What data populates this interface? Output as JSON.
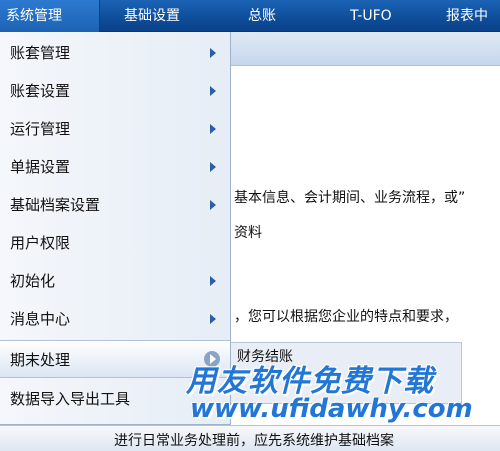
{
  "menubar": {
    "items": [
      "系统管理",
      "基础设置",
      "总账",
      "T-UFO",
      "报表中"
    ]
  },
  "dropdown": {
    "items": [
      {
        "label": "账套管理",
        "has_submenu": true
      },
      {
        "label": "账套设置",
        "has_submenu": true
      },
      {
        "label": "运行管理",
        "has_submenu": true
      },
      {
        "label": "单据设置",
        "has_submenu": true
      },
      {
        "label": "基础档案设置",
        "has_submenu": true
      },
      {
        "label": "用户权限",
        "has_submenu": false
      },
      {
        "label": "初始化",
        "has_submenu": true
      },
      {
        "label": "消息中心",
        "has_submenu": true
      },
      {
        "label": "期末处理",
        "has_submenu": true,
        "selected": true
      },
      {
        "label": "数据导入导出工具",
        "has_submenu": false
      }
    ]
  },
  "submenu": {
    "item": "财务结账"
  },
  "background": {
    "line1": "基本信息、会计期间、业务流程，或”",
    "line2": "资料",
    "line3": "，您可以根据您企业的特点和要求，",
    "bottom": "进行日常业务处理前，应先系统维护基础档案"
  },
  "watermark": {
    "title": "用友软件免费下载",
    "url": "www.ufidawhy.com"
  },
  "colors": {
    "menubar": "#0f4f9c",
    "watermark": "#2277d6",
    "menu_bg": "#eef3f9"
  }
}
